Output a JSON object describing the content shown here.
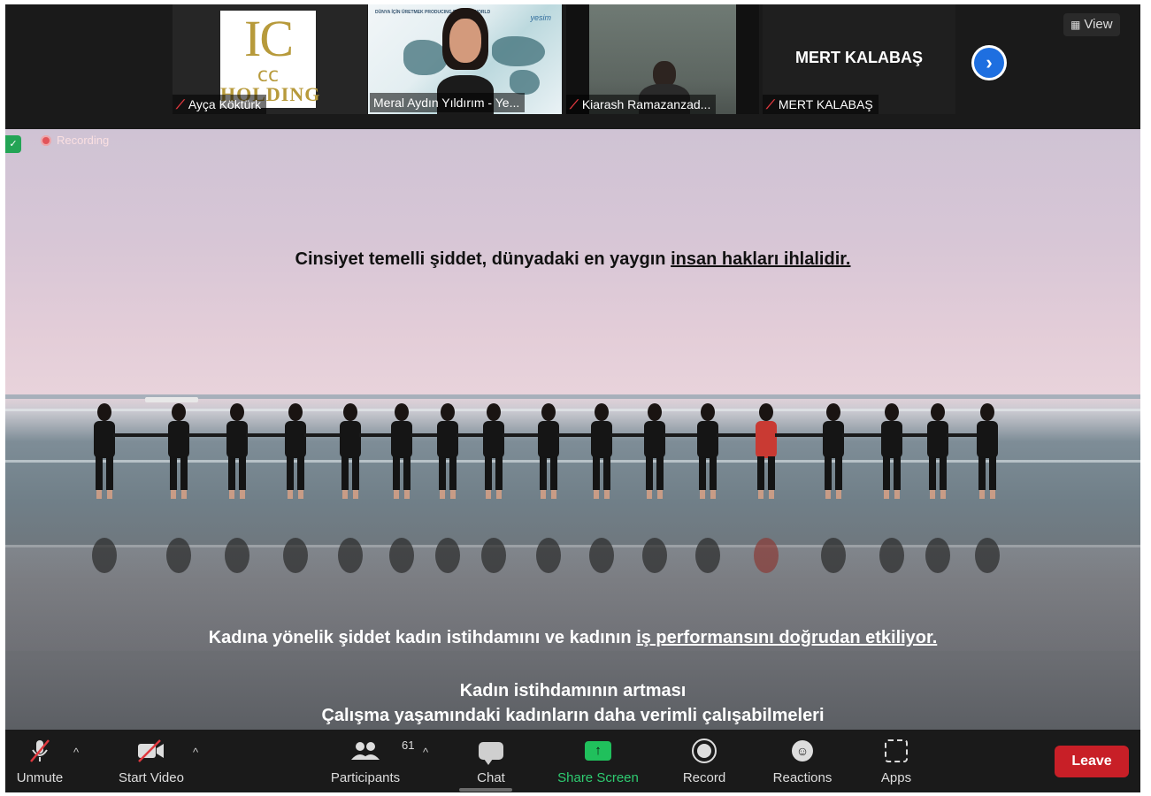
{
  "participants": [
    {
      "name": "Ayça Köktürk",
      "muted": true,
      "logo_lines": [
        "IC",
        "ⅽⅽ",
        "HOLDING"
      ]
    },
    {
      "name": "Meral Aydın Yıldırım - Ye...",
      "muted": false,
      "active_speaker": true,
      "thumb_title": "DÜNYA İÇİN ÜRETMEK\nPRODUCING FOR THE WORLD",
      "thumb_brand": "yesim"
    },
    {
      "name": "Kiarash Ramazanzad...",
      "muted": true
    },
    {
      "name": "MERT KALABAŞ",
      "muted": true,
      "display_name": "MERT KALABAŞ"
    }
  ],
  "header": {
    "view_label": "View"
  },
  "recording": {
    "label": "Recording"
  },
  "slide": {
    "line1_plain": "Cinsiyet temelli şiddet, dünyadaki en yaygın ",
    "line1_underlined": "insan hakları ihlalidir.",
    "line2_plain": "Kadına yönelik şiddet kadın istihdamını ve kadının ",
    "line2_underlined": "iş performansını doğrudan etkiliyor.",
    "line3": "Kadın istihdamının artması",
    "line4": "Çalışma yaşamındaki kadınların daha verimli çalışabilmeleri"
  },
  "toolbar": {
    "unmute": "Unmute",
    "start_video": "Start Video",
    "participants": "Participants",
    "participants_count": "61",
    "chat": "Chat",
    "share_screen": "Share Screen",
    "record": "Record",
    "reactions": "Reactions",
    "apps": "Apps",
    "leave": "Leave"
  },
  "colors": {
    "leave": "#c81f27",
    "share_green": "#20c05c",
    "next_blue": "#1e6fe0",
    "mute_red": "#e0383e"
  }
}
